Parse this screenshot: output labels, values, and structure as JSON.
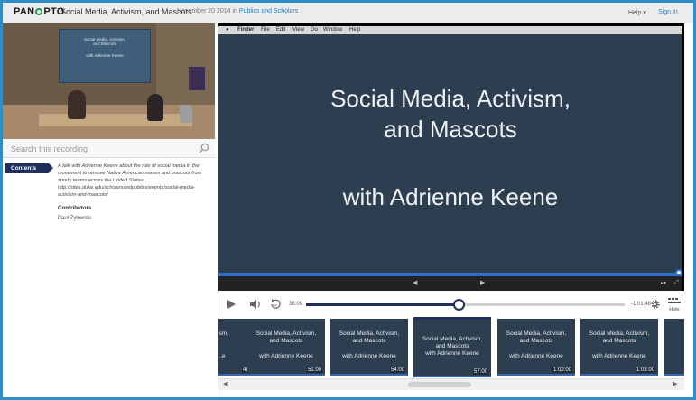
{
  "header": {
    "logo_before": "PAN",
    "logo_after": "PTO",
    "title": "Social Media, Activism, and Mascots",
    "date": "November 20 2014 in",
    "folder": "Publics and Scholars",
    "help": "Help ▾",
    "sign_in": "Sign In"
  },
  "small_video": {
    "slide_line1": "Social Media, Activism,",
    "slide_line2": "and Mascots",
    "slide_line3": "with Adrienne Keene"
  },
  "search": {
    "placeholder": "Search this recording"
  },
  "sidebar": {
    "contents_tab": "Contents",
    "description": "A talk with Adrienne Keene about the role of social media in the movement to remove Native American names and mascots from sports teams across the United States. http://sites.duke.edu/scholarsandpublics/events/social-media-activism-and-mascots/",
    "contributors_label": "Contributors",
    "contributor": "Paul Zylowski"
  },
  "mac_menu": {
    "items": [
      "Finder",
      "File",
      "Edit",
      "View",
      "Go",
      "Window",
      "Help"
    ]
  },
  "slide": {
    "title_line1": "Social Media, Activism,",
    "title_line2": "and Mascots",
    "subtitle": "with Adrienne Keene"
  },
  "controls": {
    "current_time": "38:09",
    "remaining_time": "-1:01:48",
    "progress_fraction": 0.48,
    "hide_label": "Hide"
  },
  "thumbnails": [
    {
      "line1": "...sm,",
      "line2": "",
      "line3": "...e",
      "time": "48:00",
      "active": false
    },
    {
      "line1": "Social Media, Activism,",
      "line2": "and Mascots",
      "line3": "with Adrienne Keene",
      "time": "51:00",
      "active": false
    },
    {
      "line1": "Social Media, Activism,",
      "line2": "and Mascots",
      "line3": "with Adrienne Keene",
      "time": "54:00",
      "active": false
    },
    {
      "line1": "Social Media, Activism,",
      "line2": "and Mascots",
      "line3": "with Adrienne Keene",
      "time": "57:00",
      "active": true
    },
    {
      "line1": "Social Media, Activism,",
      "line2": "and Mascots",
      "line3": "with Adrienne Keene",
      "time": "1:00:00",
      "active": false
    },
    {
      "line1": "Social Media, Activism,",
      "line2": "and Mascots",
      "line3": "with Adrienne Keene",
      "time": "1:03:00",
      "active": false
    },
    {
      "line1": "Soci",
      "line2": "",
      "line3": "wi",
      "time": "",
      "active": false
    }
  ],
  "colors": {
    "accent": "#1d2f5a",
    "slide_bg": "#2d3e50",
    "link": "#2b7bbf",
    "frame_border": "#2e8ec7"
  }
}
